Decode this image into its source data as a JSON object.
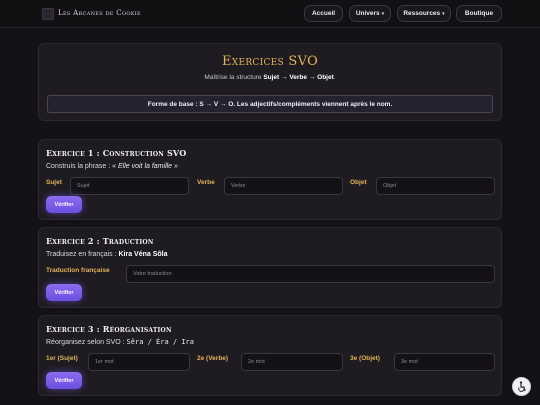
{
  "header": {
    "brand": "Les Arcanes de Cookie",
    "nav": {
      "accueil": "Accueil",
      "univers": "Univers",
      "ressources": "Ressources",
      "boutique": "Boutique"
    },
    "caret": "▾"
  },
  "hero": {
    "title": "Exercices SVO",
    "subtitle_prefix": "Maîtrise la structure ",
    "subtitle_bold": "Sujet → Verbe → Objet",
    "subtitle_suffix": ".",
    "rule": "Forme de base : S → V → O. Les adjectifs/compléments viennent après le nom."
  },
  "exercises": [
    {
      "title": "Exercice 1 : Construction SVO",
      "prompt_prefix": "Construis la phrase : ",
      "prompt_sentence": "« Elle voit la famille »",
      "fields": [
        {
          "label": "Sujet",
          "placeholder": "Sujet"
        },
        {
          "label": "Verbe",
          "placeholder": "Verbe"
        },
        {
          "label": "Objet",
          "placeholder": "Objet"
        }
      ],
      "button": "Vérifier"
    },
    {
      "title": "Exercice 2 : Traduction",
      "prompt_prefix": "Traduisez en français : ",
      "prompt_sentence": "Kira Véna Sôla",
      "fields": [
        {
          "label": "Traduction française",
          "placeholder": "Votre traduction"
        }
      ],
      "button": "Vérifier"
    },
    {
      "title": "Exercice 3 : Réorganisation",
      "prompt_prefix": "Réorganisez selon SVO : ",
      "prompt_sentence": "Sêra / Éra / Ira",
      "fields": [
        {
          "label": "1er (Sujet)",
          "placeholder": "1er mot"
        },
        {
          "label": "2e (Verbe)",
          "placeholder": "2e mot"
        },
        {
          "label": "3e (Objet)",
          "placeholder": "3e mot"
        }
      ],
      "button": "Vérifier"
    }
  ],
  "colors": {
    "accent_gold": "#e2b45a",
    "button_purple": "#7c5cf0",
    "background": "#141216",
    "card": "#1e1b21"
  },
  "icons": {
    "floating_button": "accessibility-icon"
  }
}
